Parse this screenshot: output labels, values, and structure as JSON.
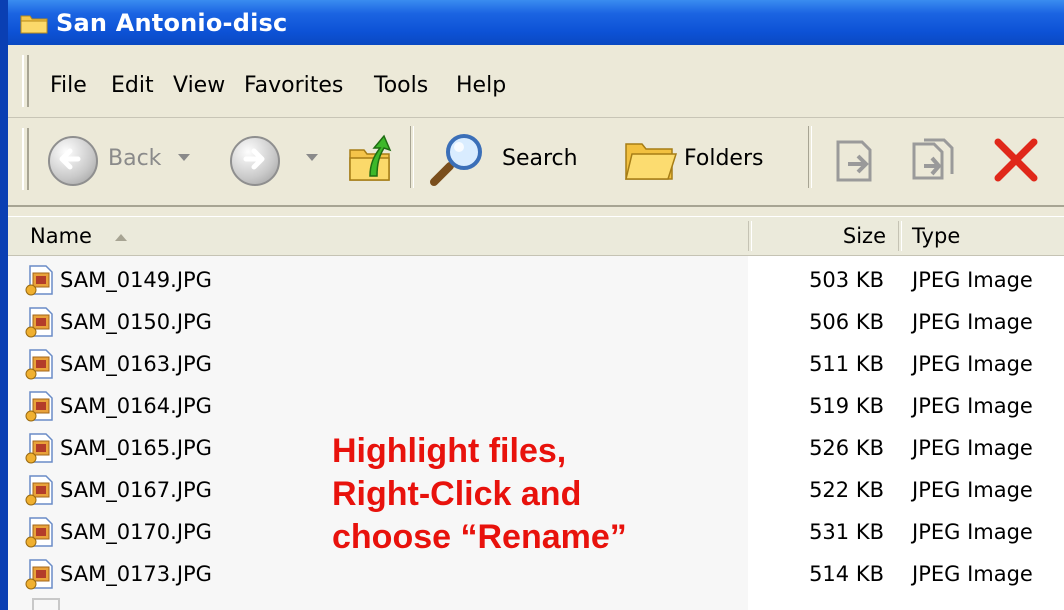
{
  "window": {
    "title": "San Antonio-disc",
    "folder_icon": "folder-icon"
  },
  "menu": {
    "items": [
      {
        "label": "File"
      },
      {
        "label": "Edit"
      },
      {
        "label": "View"
      },
      {
        "label": "Favorites"
      },
      {
        "label": "Tools"
      },
      {
        "label": "Help"
      }
    ]
  },
  "toolbar": {
    "back_label": "Back",
    "search_label": "Search",
    "folders_label": "Folders"
  },
  "columns": {
    "name": "Name",
    "size": "Size",
    "type": "Type"
  },
  "files": [
    {
      "name": "SAM_0149.JPG",
      "size": "503 KB",
      "type": "JPEG Image"
    },
    {
      "name": "SAM_0150.JPG",
      "size": "506 KB",
      "type": "JPEG Image"
    },
    {
      "name": "SAM_0163.JPG",
      "size": "511 KB",
      "type": "JPEG Image"
    },
    {
      "name": "SAM_0164.JPG",
      "size": "519 KB",
      "type": "JPEG Image"
    },
    {
      "name": "SAM_0165.JPG",
      "size": "526 KB",
      "type": "JPEG Image"
    },
    {
      "name": "SAM_0167.JPG",
      "size": "522 KB",
      "type": "JPEG Image"
    },
    {
      "name": "SAM_0170.JPG",
      "size": "531 KB",
      "type": "JPEG Image"
    },
    {
      "name": "SAM_0173.JPG",
      "size": "514 KB",
      "type": "JPEG Image"
    }
  ],
  "annotation": {
    "line1": "Highlight files,",
    "line2": "Right-Click and",
    "line3": "choose “Rename”",
    "color": "#e8120c"
  },
  "colors": {
    "desktop": "#0a3fb3",
    "titlebar": "#0d52d6",
    "chrome": "#ece9d8"
  }
}
